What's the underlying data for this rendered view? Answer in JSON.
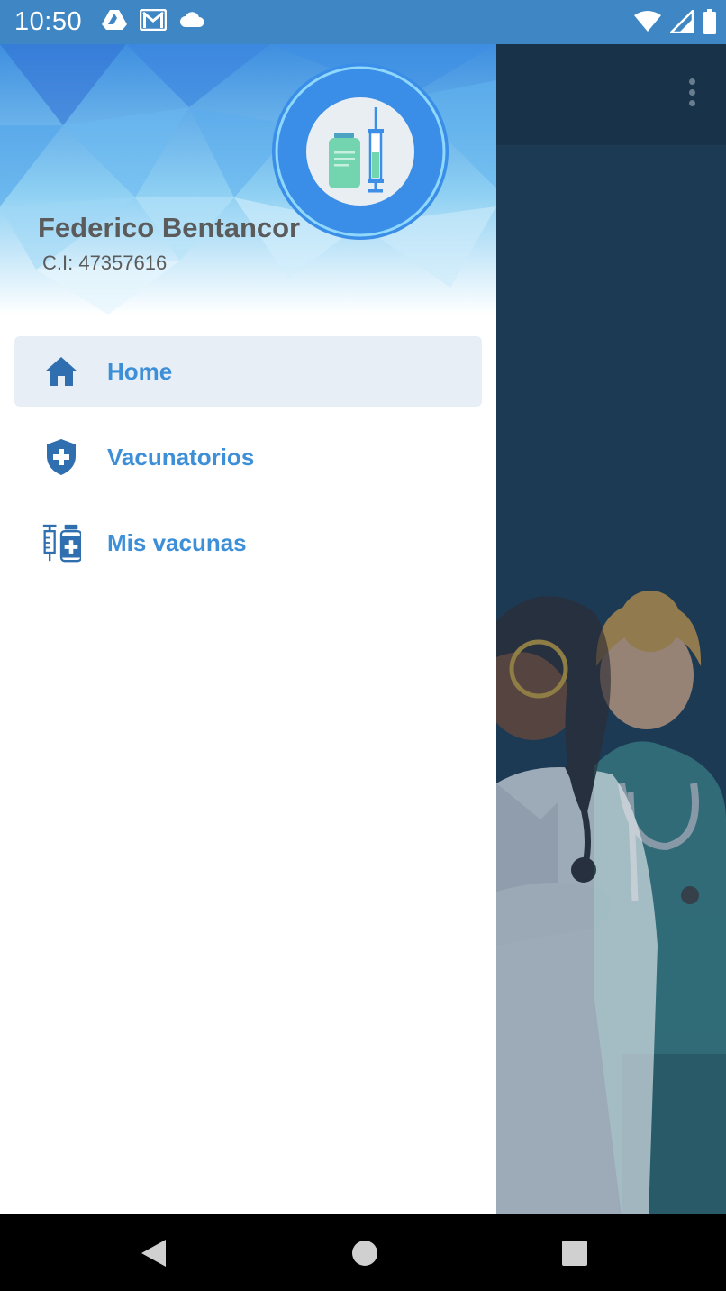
{
  "status_bar": {
    "time": "10:50",
    "notification_icons": [
      "drive-icon",
      "gmail-icon",
      "cloud-icon"
    ],
    "system_icons": [
      "wifi-icon",
      "signal-icon",
      "battery-icon"
    ]
  },
  "drawer": {
    "user": {
      "name": "Federico Bentancor",
      "ci": "C.I: 47357616"
    },
    "menu": [
      {
        "label": "Home",
        "icon": "home-icon",
        "active": true
      },
      {
        "label": "Vacunatorios",
        "icon": "shield-plus-icon",
        "active": false
      },
      {
        "label": "Mis vacunas",
        "icon": "vaccine-icon",
        "active": false
      }
    ]
  },
  "colors": {
    "status_bar": "#3f86c4",
    "accent": "#3d8fd8",
    "active_item_bg": "#e8eef5",
    "scrim_bg": "#1d3a55"
  }
}
